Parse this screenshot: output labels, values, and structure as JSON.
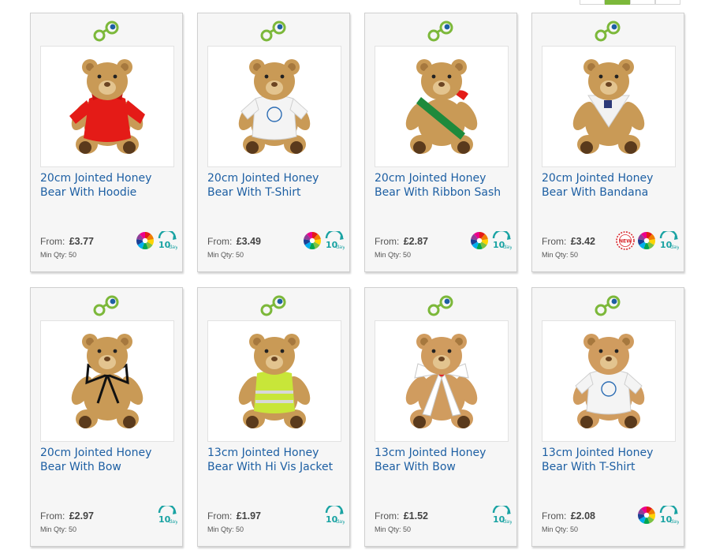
{
  "pagination": {
    "pages": [
      "",
      "",
      "",
      ""
    ],
    "active_index": 1
  },
  "products": [
    {
      "title": "20cm Jointed Honey Bear With Hoodie",
      "from_label": "From:",
      "price": "£3.77",
      "min_qty": "Min Qty: 50",
      "badges": [
        "colour-wheel",
        "10-day"
      ],
      "garment": "hoodie",
      "garment_color": "#e41b17",
      "bear_color": "#c99a56"
    },
    {
      "title": "20cm Jointed Honey Bear With T-Shirt",
      "from_label": "From:",
      "price": "£3.49",
      "min_qty": "Min Qty: 50",
      "badges": [
        "colour-wheel",
        "10-day"
      ],
      "garment": "tshirt",
      "garment_color": "#f4f4f4",
      "bear_color": "#c99a56"
    },
    {
      "title": "20cm Jointed Honey Bear With Ribbon Sash",
      "from_label": "From:",
      "price": "£2.87",
      "min_qty": "Min Qty: 50",
      "badges": [
        "colour-wheel",
        "10-day"
      ],
      "garment": "sash",
      "garment_color": "#1e8a3c",
      "bear_color": "#c99a56"
    },
    {
      "title": "20cm Jointed Honey Bear With Bandana",
      "from_label": "From:",
      "price": "£3.42",
      "min_qty": "Min Qty: 50",
      "badges": [
        "new",
        "colour-wheel",
        "10-day"
      ],
      "new_label": "NEW",
      "garment": "bandana",
      "garment_color": "#f2f2f2",
      "bear_color": "#c99a56"
    },
    {
      "title": "20cm Jointed Honey Bear With Bow",
      "from_label": "From:",
      "price": "£2.97",
      "min_qty": "Min Qty: 50",
      "badges": [
        "10-day"
      ],
      "garment": "bow",
      "garment_color": "#111111",
      "bear_color": "#c99a56"
    },
    {
      "title": "13cm Jointed Honey Bear With Hi Vis Jacket",
      "from_label": "From:",
      "price": "£1.97",
      "min_qty": "Min Qty: 50",
      "badges": [
        "10-day"
      ],
      "garment": "hivis",
      "garment_color": "#c8e639",
      "bear_color": "#c99a56"
    },
    {
      "title": "13cm Jointed Honey Bear With Bow",
      "from_label": "From:",
      "price": "£1.52",
      "min_qty": "Min Qty: 50",
      "badges": [
        "10-day"
      ],
      "garment": "ribbonbow",
      "garment_color": "#ffffff",
      "bear_color": "#d09c5f"
    },
    {
      "title": "13cm Jointed Honey Bear With T-Shirt",
      "from_label": "From:",
      "price": "£2.08",
      "min_qty": "Min Qty: 50",
      "badges": [
        "colour-wheel",
        "10-day"
      ],
      "garment": "tshirt",
      "garment_color": "#f4f4f4",
      "bear_color": "#d09c5f"
    }
  ],
  "badge_text": {
    "ten_day_number": "10",
    "ten_day_word": "day"
  },
  "colors": {
    "link_blue": "#1d5fa3",
    "teal": "#1aa3a3",
    "logo_green": "#7cb83a",
    "logo_blue": "#1d5fa3"
  },
  "icons": {
    "logo": "link-chain-logo-icon",
    "colour": "colour-wheel-icon",
    "ten_day": "ten-day-delivery-icon",
    "new": "new-badge-icon"
  }
}
